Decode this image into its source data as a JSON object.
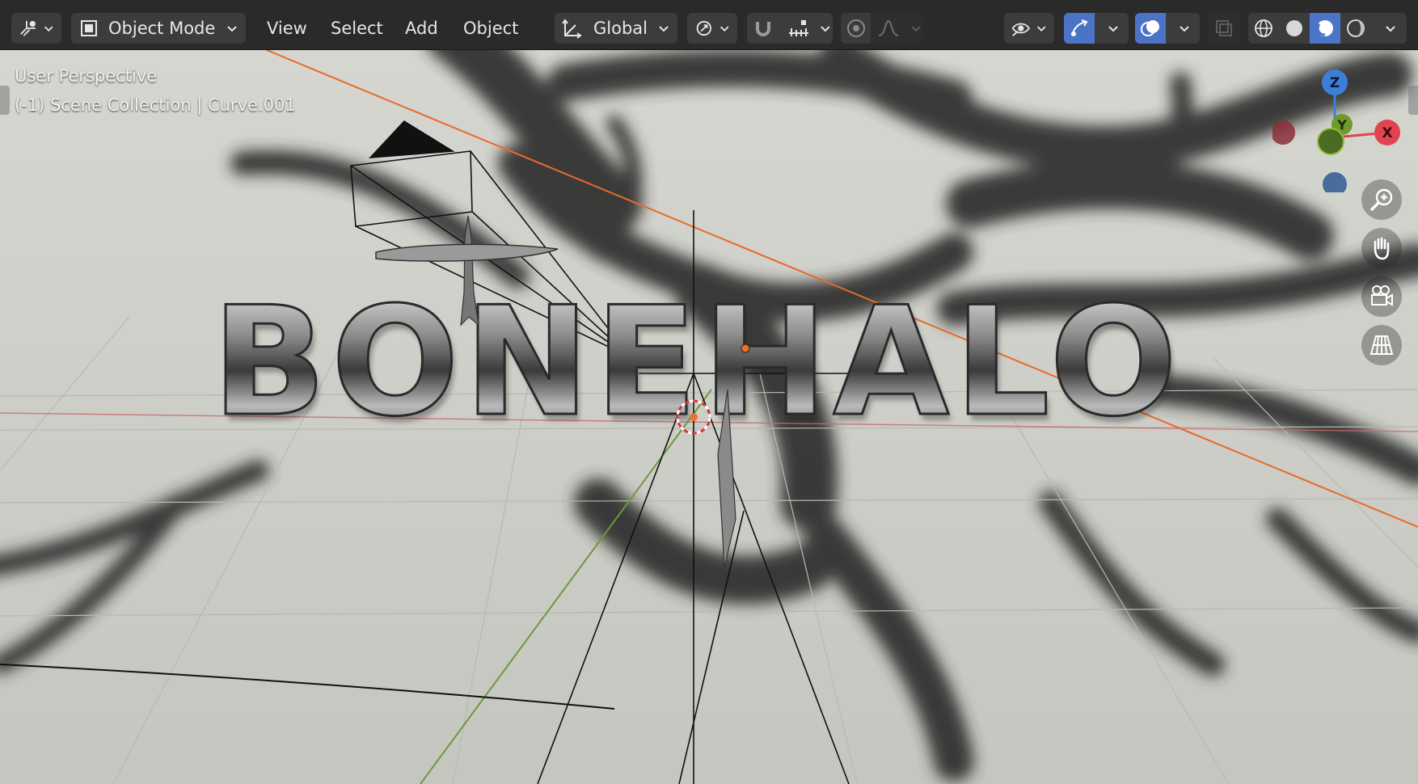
{
  "header": {
    "mode_label": "Object Mode",
    "menus": [
      "View",
      "Select",
      "Add",
      "Object"
    ],
    "orientation_label": "Global"
  },
  "viewport": {
    "perspective_label": "User Perspective",
    "collection_label": "(-1) Scene Collection | Curve.001",
    "scene_text": "BONEHALO"
  },
  "gizmo": {
    "z_label": "Z",
    "x_label": "X",
    "y_label": "Y"
  },
  "colors": {
    "header_bg": "#2a2a2a",
    "button_bg": "#3c3c3c",
    "accent_blue": "#4b73c6",
    "axis_x": "#e0454f",
    "axis_y": "#8fbf3a",
    "axis_z": "#3d7fd6",
    "viewport_bg": "#cfcfca",
    "x_axis_line": "#e86a2a"
  },
  "nav_icons": [
    "zoom-icon",
    "hand-pan-icon",
    "camera-view-icon",
    "grid-ortho-icon"
  ]
}
